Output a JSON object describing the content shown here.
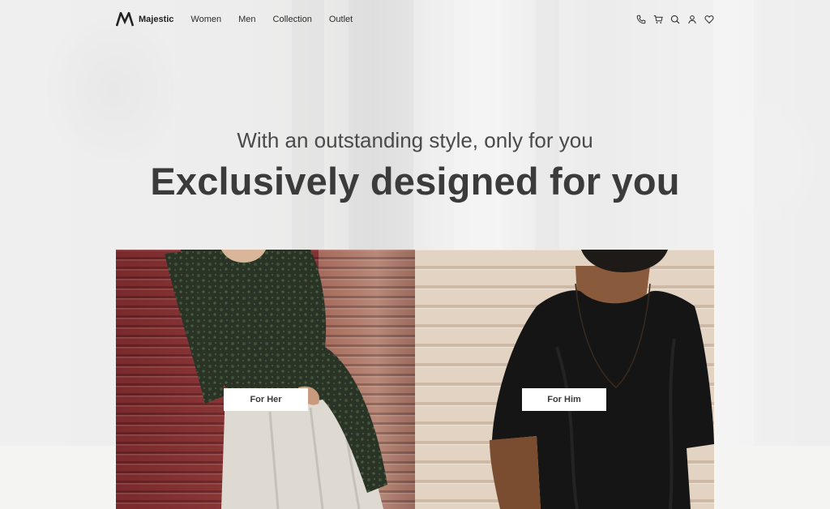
{
  "brand": {
    "name": "Majestic",
    "logo_icon": "m-logo-icon"
  },
  "nav": {
    "links": [
      "Women",
      "Men",
      "Collection",
      "Outlet"
    ],
    "icons": [
      "phone-icon",
      "cart-icon",
      "search-icon",
      "user-icon",
      "heart-icon"
    ]
  },
  "hero": {
    "subtitle": "With an outstanding style, only for you",
    "headline": "Exclusively designed for you"
  },
  "cards": [
    {
      "label": "For Her",
      "photo": "woman-in-green-paisley-shirt"
    },
    {
      "label": "For Him",
      "photo": "man-in-black-tshirt"
    }
  ]
}
